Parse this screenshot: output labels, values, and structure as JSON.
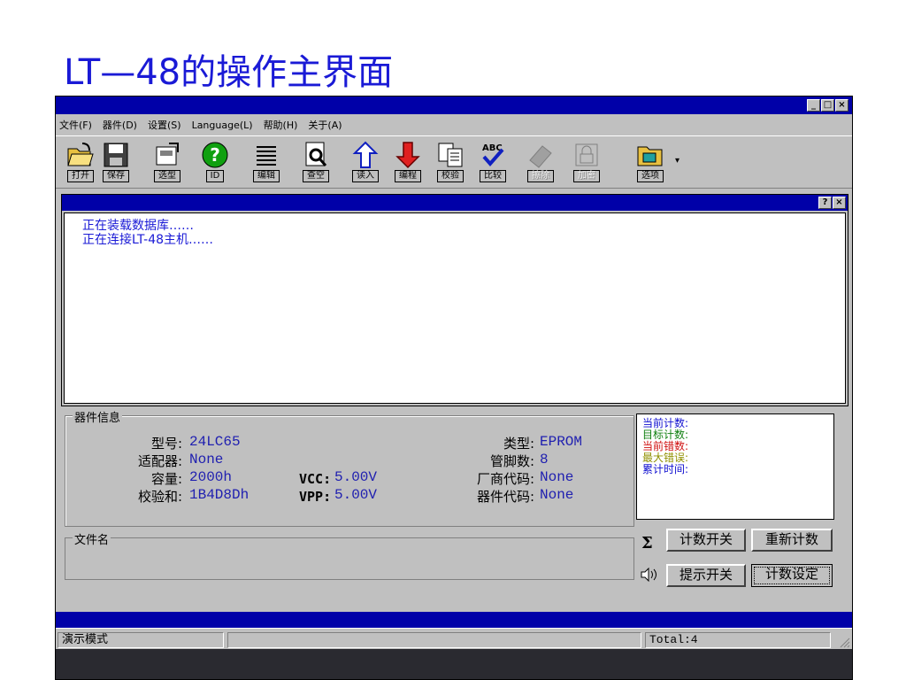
{
  "slide_title": "LT—48的操作主界面",
  "window": {
    "controls": {
      "minimize": "_",
      "maximize": "□",
      "close": "×"
    }
  },
  "menu": [
    "文件(F)",
    "器件(D)",
    "设置(S)",
    "Language(L)",
    "帮助(H)",
    "关于(A)"
  ],
  "toolbar": [
    {
      "label": "打开",
      "icon": "open-folder-icon",
      "enabled": true
    },
    {
      "label": "保存",
      "icon": "save-disk-icon",
      "enabled": true
    },
    {
      "label": "选型",
      "icon": "select-device-icon",
      "enabled": true
    },
    {
      "label": "ID",
      "icon": "help-question-icon",
      "enabled": true
    },
    {
      "label": "编辑",
      "icon": "edit-lines-icon",
      "enabled": true
    },
    {
      "label": "查空",
      "icon": "blank-check-icon",
      "enabled": true
    },
    {
      "label": "读入",
      "icon": "read-arrow-up-icon",
      "enabled": true
    },
    {
      "label": "编程",
      "icon": "program-arrow-down-icon",
      "enabled": true
    },
    {
      "label": "校验",
      "icon": "verify-pages-icon",
      "enabled": true
    },
    {
      "label": "比较",
      "icon": "compare-abc-icon",
      "enabled": true
    },
    {
      "label": "擦除",
      "icon": "erase-chip-icon",
      "enabled": false
    },
    {
      "label": "加密",
      "icon": "encrypt-lock-icon",
      "enabled": false
    },
    {
      "label": "选项",
      "icon": "options-folder-icon",
      "enabled": true
    }
  ],
  "child_window": {
    "controls": {
      "help": "?",
      "close": "×"
    }
  },
  "log_lines": [
    "正在装载数据库……",
    "正在连接LT-48主机……"
  ],
  "device_info": {
    "title": "器件信息",
    "model_label": "型号:",
    "model_value": "24LC65",
    "adapter_label": "适配器:",
    "adapter_value": "None",
    "capacity_label": "容量:",
    "capacity_value": "2000h",
    "checksum_label": "校验和:",
    "checksum_value": "1B4D8Dh",
    "vcc_label": "VCC:",
    "vcc_value": "5.00V",
    "vpp_label": "VPP:",
    "vpp_value": "5.00V",
    "type_label": "类型:",
    "type_value": "EPROM",
    "pins_label": "管脚数:",
    "pins_value": "8",
    "vendor_code_label": "厂商代码:",
    "vendor_code_value": "None",
    "device_code_label": "器件代码:",
    "device_code_value": "None"
  },
  "file_group": {
    "title": "文件名"
  },
  "counters": [
    {
      "label": "当前计数:",
      "color": "#1010d0"
    },
    {
      "label": "目标计数:",
      "color": "#108010"
    },
    {
      "label": "当前错数:",
      "color": "#d01010"
    },
    {
      "label": "最大错误:",
      "color": "#909000"
    },
    {
      "label": "累计时间:",
      "color": "#1010d0"
    }
  ],
  "buttons": {
    "sigma": "Σ",
    "count_toggle": "计数开关",
    "reset_count": "重新计数",
    "prompt_toggle": "提示开关",
    "count_setting": "计数设定"
  },
  "status": {
    "mode": "演示模式",
    "middle": "",
    "total": "Total:4"
  },
  "colors": {
    "titlebar": "#0000a8",
    "face": "#c0c0c0",
    "title_text": "#1a1ad6"
  }
}
